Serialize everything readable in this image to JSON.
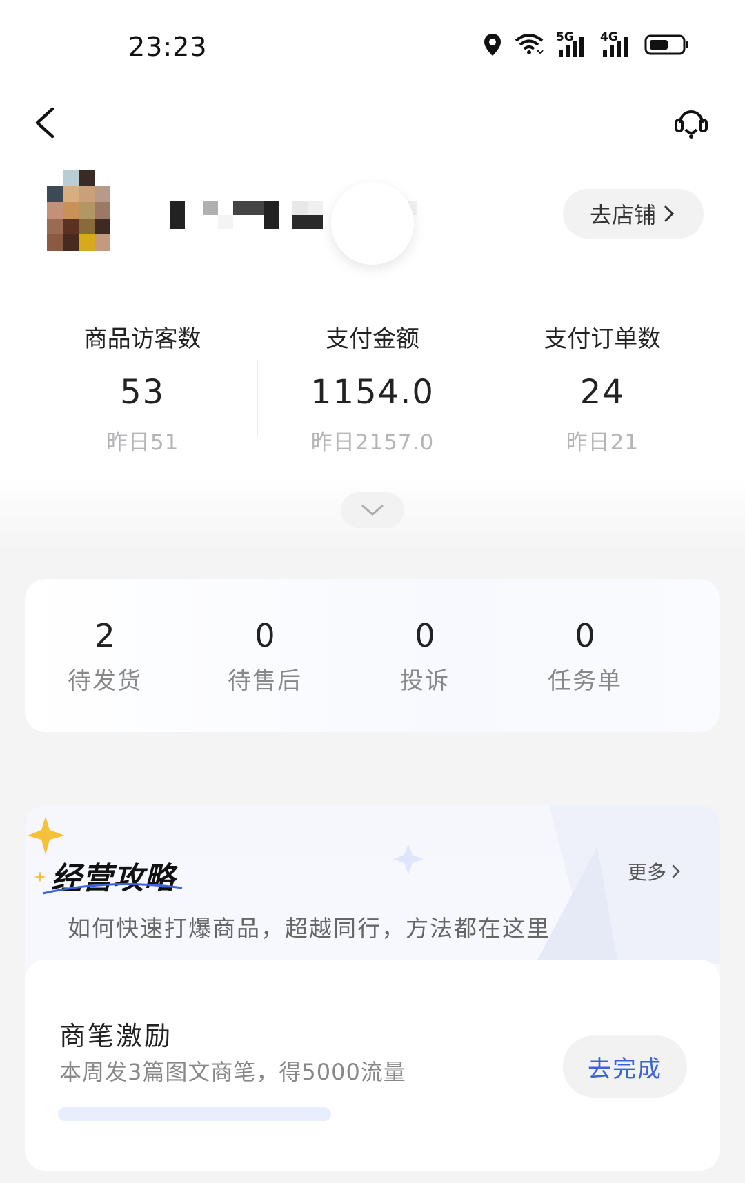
{
  "status_bar": {
    "time": "23:23",
    "signal_1_label": "5G",
    "signal_2_label": "4G",
    "icons": [
      "location-icon",
      "wifi-icon",
      "signal-5g-icon",
      "signal-4g-icon",
      "battery-icon"
    ]
  },
  "nav": {
    "back_icon": "chevron-left-icon",
    "support_icon": "headset-icon"
  },
  "shop": {
    "goto_shop_label": "去店铺"
  },
  "metrics": [
    {
      "label": "商品访客数",
      "value": "53",
      "yesterday": "昨日51"
    },
    {
      "label": "支付金额",
      "value": "1154.0",
      "yesterday": "昨日2157.0"
    },
    {
      "label": "支付订单数",
      "value": "24",
      "yesterday": "昨日21"
    }
  ],
  "orders": [
    {
      "count": "2",
      "label": "待发货"
    },
    {
      "count": "0",
      "label": "待售后"
    },
    {
      "count": "0",
      "label": "投诉"
    },
    {
      "count": "0",
      "label": "任务单"
    }
  ],
  "strategy": {
    "title": "经营攻略",
    "more_label": "更多",
    "description": "如何快速打爆商品，超越同行，方法都在这里",
    "task": {
      "title": "商笔激励",
      "description": "本周发3篇图文商笔，得5000流量",
      "button_label": "去完成",
      "progress": 0
    }
  },
  "colors": {
    "accent_blue": "#3b64d8",
    "star_gold": "#f6c13a"
  }
}
